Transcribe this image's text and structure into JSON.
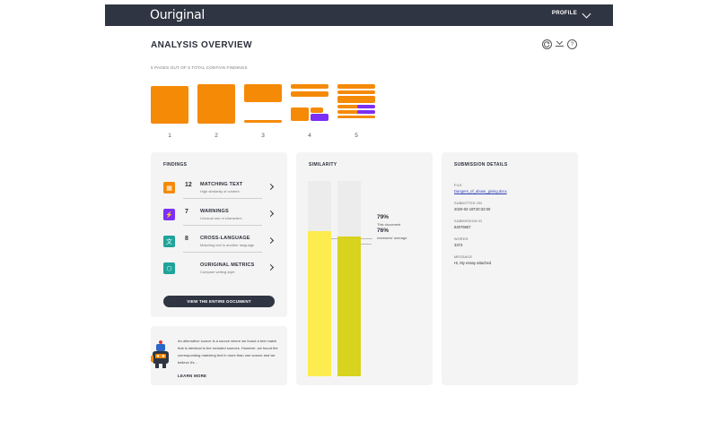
{
  "header": {
    "logo": "Ouriginal",
    "profile_label": "PROFILE"
  },
  "title": "ANALYSIS OVERVIEW",
  "toolbar": {
    "icons": [
      "refresh-icon",
      "download-icon",
      "help-icon"
    ],
    "help_glyph": "?"
  },
  "pages": {
    "label": "5 PAGES OUT OF 5 TOTAL CONTAIN FINDINGS",
    "numbers": [
      "1",
      "2",
      "3",
      "4",
      "5"
    ]
  },
  "findings": {
    "heading": "FINDINGS",
    "items": [
      {
        "count": "12",
        "name": "MATCHING TEXT",
        "sub": "High similarity of content",
        "icon": "matching-text-icon",
        "color": "#f58a07",
        "glyph": "▦"
      },
      {
        "count": "7",
        "name": "WARNINGS",
        "sub": "Unusual use of characters",
        "icon": "warning-bolt-icon",
        "color": "#7b2ff7",
        "glyph": "⚡"
      },
      {
        "count": "8",
        "name": "CROSS-LANGUAGE",
        "sub": "Matching text in another language",
        "icon": "translate-icon",
        "color": "#1fa39a",
        "glyph": "文"
      },
      {
        "count": "",
        "name": "OURIGINAL METRICS",
        "sub": "Compare writing style",
        "icon": "metrics-hexagon-icon",
        "color": "#1fa39a",
        "glyph": "⬡"
      }
    ],
    "button_label": "VIEW THE ENTIRE DOCUMENT"
  },
  "info": {
    "text": "An alternative source is a source where we found a text match that is identical to the included sources. However, we found the corresponding matching text in more than one source and we believe it's...",
    "learn_more": "LEARN MORE"
  },
  "similarity": {
    "heading": "SIMILARITY",
    "bars": [
      {
        "percent": 79,
        "label": "79%",
        "caption": "This document",
        "color": "#fcec50"
      },
      {
        "percent": 76,
        "label": "76%",
        "caption": "reviewers' average",
        "color": "#d8d31e"
      }
    ]
  },
  "submission": {
    "heading": "SUBMISSION DETAILS",
    "file_label": "FILE",
    "file_value": "Dangers_of_abuse_giving.docx",
    "submitted_label": "SUBMITTED ON",
    "submitted_value": "2020-02-18T20:32:00",
    "id_label": "SUBMISSION ID",
    "id_value": "64076667",
    "words_label": "WORDS",
    "words_value": "3373",
    "message_label": "MESSAGE",
    "message_value": "Hi, My essay attached"
  }
}
